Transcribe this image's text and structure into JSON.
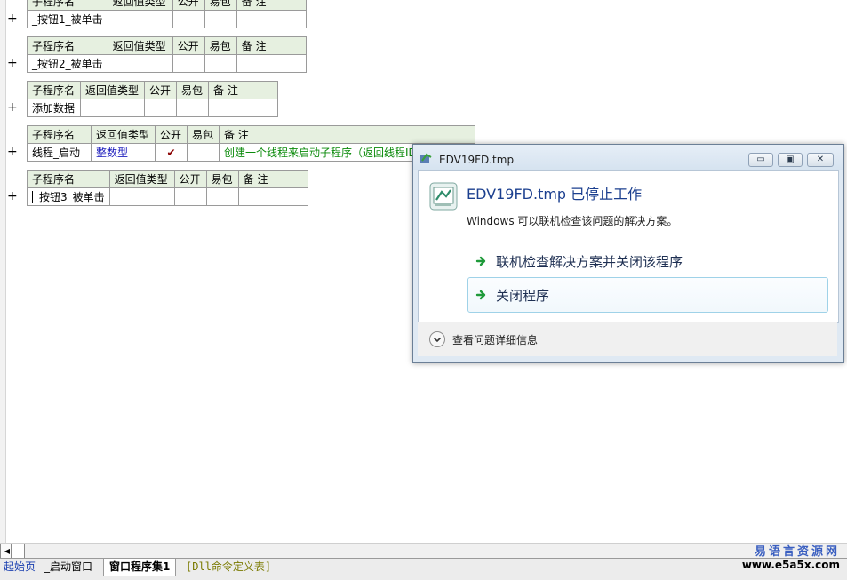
{
  "headers": {
    "name": "子程序名",
    "return_type": "返回值类型",
    "public": "公开",
    "easy_pkg": "易包",
    "remark": "备 注"
  },
  "expand_symbol": "+",
  "subroutines": [
    {
      "name": "_按钮1_被单击",
      "return_type": "",
      "public": "",
      "easy_pkg": "",
      "remark": ""
    },
    {
      "name": "_按钮2_被单击",
      "return_type": "",
      "public": "",
      "easy_pkg": "",
      "remark": ""
    },
    {
      "name": "添加数据",
      "return_type": "",
      "public": "",
      "easy_pkg": "",
      "remark": ""
    },
    {
      "name": "线程_启动",
      "return_type": "整数型",
      "public": "✔",
      "easy_pkg": "",
      "remark": "创建一个线程来启动子程序（返回线程ID"
    },
    {
      "name": "_按钮3_被单击",
      "return_type": "",
      "public": "",
      "easy_pkg": "",
      "remark": ""
    }
  ],
  "tabs": {
    "start_page": "起始页",
    "startup_window": "_启动窗口",
    "window_program_set": "窗口程序集1",
    "dll_table": "[Dll命令定义表]"
  },
  "brand": {
    "name": "易语言资源网",
    "url": "www.e5a5x.com"
  },
  "dialog": {
    "window_title": "EDV19FD.tmp",
    "main_instruction": "EDV19FD.tmp 已停止工作",
    "content": "Windows 可以联机检查该问题的解决方案。",
    "option_check_online": "联机检查解决方案并关闭该程序",
    "option_close": "关闭程序",
    "details_label": "查看问题详细信息",
    "window_buttons": {
      "minimize": "▭",
      "maximize": "▣",
      "close": "✕"
    }
  },
  "colors": {
    "header_bg": "#e6f0e0",
    "int_type": "#1d1dbd",
    "remark_green": "#0a8a0a",
    "dialog_title": "#1b3f8f"
  }
}
